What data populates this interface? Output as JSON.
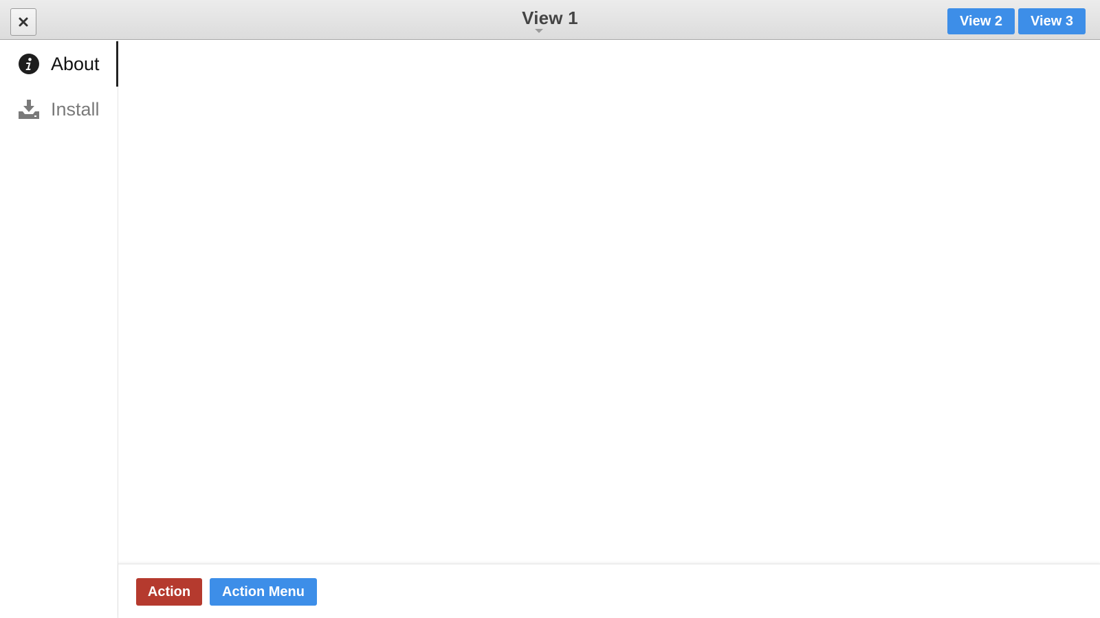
{
  "header": {
    "close_icon": "close-icon",
    "title": "View 1",
    "title_caret_icon": "caret-down-icon",
    "view_buttons": [
      {
        "label": "View 2"
      },
      {
        "label": "View 3"
      }
    ]
  },
  "sidebar": {
    "items": [
      {
        "label": "About",
        "icon": "info-circle-icon",
        "active": true
      },
      {
        "label": "Install",
        "icon": "download-tray-icon",
        "active": false
      }
    ]
  },
  "footer": {
    "action_label": "Action",
    "action_menu_label": "Action Menu"
  },
  "colors": {
    "primary_button": "#3d8ee8",
    "danger_button": "#b53a2e",
    "active_item_text": "#111111",
    "inactive_item_text": "#7a7a7a"
  }
}
